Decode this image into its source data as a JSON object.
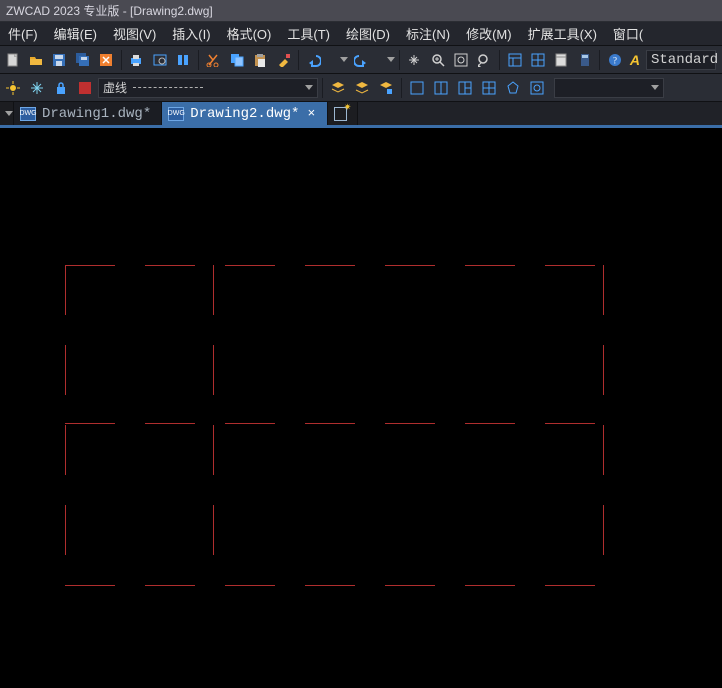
{
  "titlebar": "ZWCAD 2023 专业版 - [Drawing2.dwg]",
  "menu": {
    "file": "件(F)",
    "edit": "编辑(E)",
    "view": "视图(V)",
    "insert": "插入(I)",
    "format": "格式(O)",
    "tools": "工具(T)",
    "draw": "绘图(D)",
    "dim": "标注(N)",
    "modify": "修改(M)",
    "ext": "扩展工具(X)",
    "window": "窗口("
  },
  "toolbar1": {
    "style_name": "Standard"
  },
  "toolbar2": {
    "linetype_label": "虚线"
  },
  "tabs": {
    "0": {
      "label": "Drawing1.dwg*"
    },
    "1": {
      "label": "Drawing2.dwg*",
      "close": "×"
    }
  }
}
